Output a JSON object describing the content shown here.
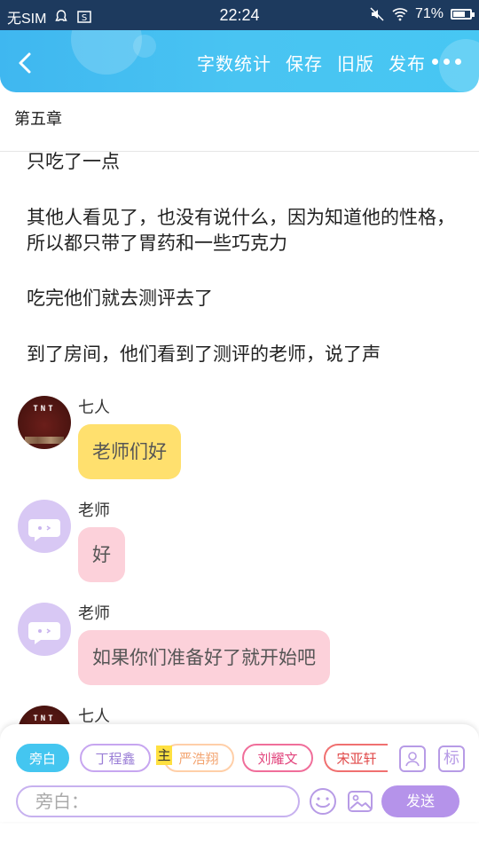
{
  "status_bar": {
    "carrier": "无SIM",
    "time": "22:24",
    "battery": "71%",
    "battery_level": 0.71
  },
  "header": {
    "actions": [
      "字数统计",
      "保存",
      "旧版",
      "发布"
    ]
  },
  "chapter": {
    "title": "第五章"
  },
  "paragraphs": [
    "只吃了一点",
    "其他人看见了，也没有说什么，因为知道他的性格，所以都只带了胃药和一些巧克力",
    "吃完他们就去测评去了",
    "到了房间，他们看到了测评的老师，说了声"
  ],
  "messages": [
    {
      "speaker": "七人",
      "text": "老师们好",
      "avatar": "TNT"
    },
    {
      "speaker": "老师",
      "text": "好"
    },
    {
      "speaker": "老师",
      "text": "如果你们准备好了就开始吧"
    },
    {
      "speaker": "七人",
      "text": "",
      "avatar": "TNT"
    }
  ],
  "composer": {
    "roles": [
      "旁白",
      "丁程鑫",
      "严浩翔",
      "刘耀文",
      "宋亚轩"
    ],
    "host_badge": "主",
    "tool_mark": "标",
    "input_placeholder": "旁白：",
    "send_label": "发送"
  },
  "colors": {
    "accent": "#44c6f0",
    "purple": "#b593ea",
    "yellow_bubble": "#ffe06e",
    "pink_bubble": "#fcd1da"
  }
}
